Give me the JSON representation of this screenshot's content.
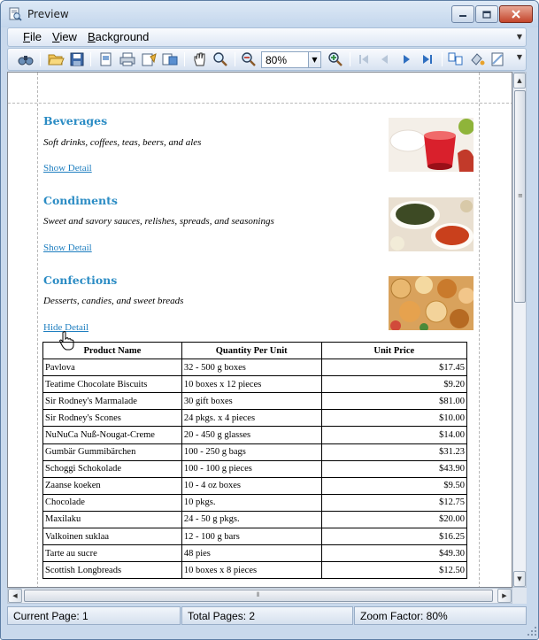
{
  "window": {
    "title": "Preview",
    "title_icon": "preview-app-icon",
    "caption_buttons": [
      "minimize",
      "maximize",
      "close"
    ]
  },
  "menu": {
    "items": [
      {
        "label": "File"
      },
      {
        "label": "View"
      },
      {
        "label": "Background"
      }
    ]
  },
  "toolbar": {
    "icons": [
      "find-icon",
      "open-icon",
      "save-icon",
      "page-setup-icon",
      "print-icon",
      "quick-print-icon",
      "export-icon",
      "hand-tool-icon",
      "magnifier-icon",
      "zoom-out-icon",
      "zoom-in-icon",
      "first-page-icon",
      "previous-page-icon",
      "next-page-icon",
      "last-page-icon",
      "multiple-pages-icon",
      "background-color-icon",
      "watermark-icon"
    ],
    "zoom_value": "80%"
  },
  "report": {
    "categories": [
      {
        "name": "Beverages",
        "description": "Soft drinks, coffees, teas, beers, and ales",
        "link": "Show Detail",
        "image": "beverages-photo"
      },
      {
        "name": "Condiments",
        "description": "Sweet and savory sauces, relishes, spreads, and seasonings",
        "link": "Show Detail",
        "image": "condiments-photo"
      },
      {
        "name": "Confections",
        "description": "Desserts, candies, and sweet breads",
        "link": "Hide Detail",
        "image": "confections-photo"
      }
    ],
    "table": {
      "columns": [
        "Product Name",
        "Quantity Per Unit",
        "Unit Price"
      ],
      "rows": [
        [
          "Pavlova",
          "32 - 500 g boxes",
          "$17.45"
        ],
        [
          "Teatime Chocolate Biscuits",
          "10 boxes x 12 pieces",
          "$9.20"
        ],
        [
          "Sir Rodney's Marmalade",
          "30 gift boxes",
          "$81.00"
        ],
        [
          "Sir Rodney's Scones",
          "24 pkgs. x 4 pieces",
          "$10.00"
        ],
        [
          "NuNuCa Nuß-Nougat-Creme",
          "20 - 450 g glasses",
          "$14.00"
        ],
        [
          "Gumbär Gummibärchen",
          "100 - 250 g bags",
          "$31.23"
        ],
        [
          "Schoggi Schokolade",
          "100 - 100 g pieces",
          "$43.90"
        ],
        [
          "Zaanse koeken",
          "10 - 4 oz boxes",
          "$9.50"
        ],
        [
          "Chocolade",
          "10 pkgs.",
          "$12.75"
        ],
        [
          "Maxilaku",
          "24 - 50 g pkgs.",
          "$20.00"
        ],
        [
          "Valkoinen suklaa",
          "12 - 100 g bars",
          "$16.25"
        ],
        [
          "Tarte au sucre",
          "48 pies",
          "$49.30"
        ],
        [
          "Scottish Longbreads",
          "10 boxes x 8 pieces",
          "$12.50"
        ]
      ]
    }
  },
  "status": {
    "current_page": "Current Page: 1",
    "total_pages": "Total Pages: 2",
    "zoom_factor": "Zoom Factor: 80%"
  },
  "colors": {
    "category_title": "#2b8cc4",
    "link": "#1f7fc0",
    "chrome": "#c9d9ec"
  }
}
